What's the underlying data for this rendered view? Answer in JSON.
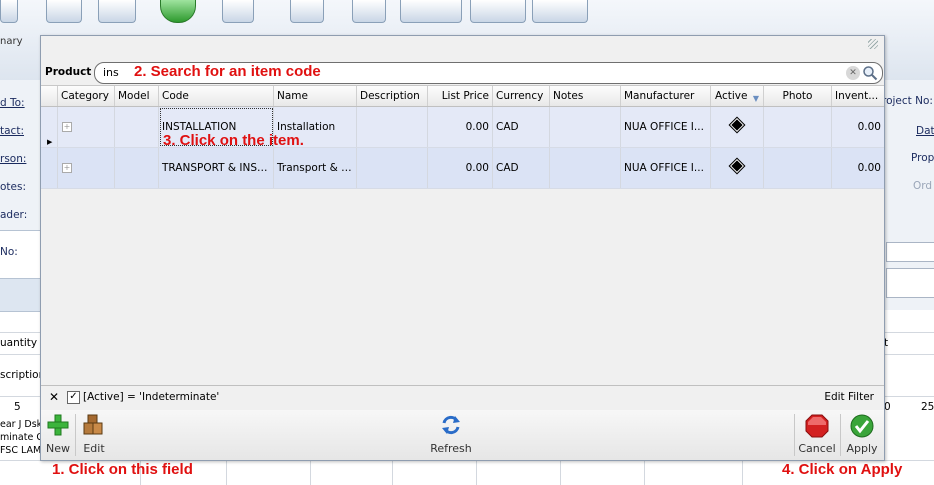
{
  "background": {
    "ribbon_label": "nary",
    "left_labels": [
      {
        "text": "d To:",
        "underline": true
      },
      {
        "text": "tact:",
        "underline": true
      },
      {
        "text": "rson:",
        "underline": true
      },
      {
        "text": "otes:",
        "underline": false
      },
      {
        "text": "ader:",
        "underline": false
      },
      {
        "text": "No:",
        "underline": false
      }
    ],
    "right_labels": [
      "roject No:",
      "Dat",
      "Prop",
      "Ord"
    ],
    "lower_left": [
      "uantity",
      "scription",
      "5",
      "ear J Dsk",
      "minate Gr",
      "FSC LAM"
    ],
    "lower_right": [
      "t",
      "0",
      "25"
    ]
  },
  "popup": {
    "search_label": "Product :",
    "search_value": "ins",
    "columns": [
      "Category",
      "Model",
      "Code",
      "Name",
      "Description",
      "List Price",
      "Currency",
      "Notes",
      "Manufacturer",
      "Active",
      "Photo",
      "Invent..."
    ],
    "rows": [
      {
        "category": "",
        "model": "",
        "code": "INSTALLATION",
        "name": "Installation",
        "description": "",
        "list_price": "0.00",
        "currency": "CAD",
        "notes": "",
        "manufacturer": "NUA OFFICE I...",
        "active": true,
        "photo": "",
        "inventory": "0.00"
      },
      {
        "category": "",
        "model": "",
        "code": "TRANSPORT & INST...",
        "name": "Transport & I...",
        "description": "",
        "list_price": "0.00",
        "currency": "CAD",
        "notes": "",
        "manufacturer": "NUA OFFICE I...",
        "active": true,
        "photo": "",
        "inventory": "0.00"
      }
    ],
    "filter_text": "[Active] = 'Indeterminate'",
    "edit_filter": "Edit Filter",
    "toolbar": {
      "new": "New",
      "edit": "Edit",
      "refresh": "Refresh",
      "cancel": "Cancel",
      "apply": "Apply"
    }
  },
  "annotations": {
    "step1": "1. Click on this field",
    "step2": "2. Search for an item code",
    "step3": "3. Click on the item.",
    "step4": "4. Click on Apply"
  },
  "colors": {
    "annotation": "#e01010",
    "selected_row": "#e4e9f7",
    "alt_row": "#dbe3f5",
    "apply_green": "#3aa53a",
    "cancel_red": "#d32020",
    "new_green": "#3cb43c"
  }
}
